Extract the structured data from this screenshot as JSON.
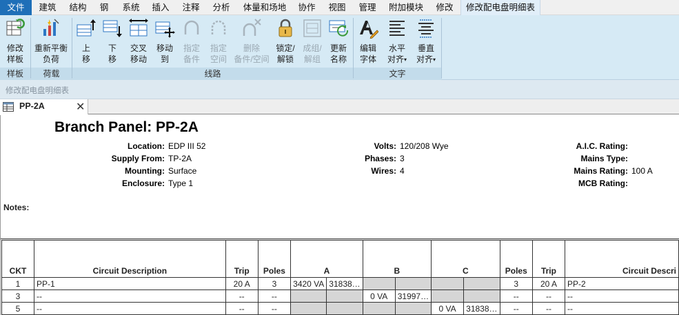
{
  "menubar": {
    "items": [
      "文件",
      "建筑",
      "结构",
      "钢",
      "系统",
      "插入",
      "注释",
      "分析",
      "体量和场地",
      "协作",
      "视图",
      "管理",
      "附加模块",
      "修改",
      "修改配电盘明细表"
    ]
  },
  "ribbon": {
    "tools": [
      {
        "line1": "修改",
        "line2": "样板",
        "icon": "modify-template-icon",
        "enabled": true
      },
      {
        "line1": "重新平衡",
        "line2": "负荷",
        "icon": "rebalance-loads-icon",
        "enabled": true
      },
      {
        "line1": "上",
        "line2": "移",
        "icon": "move-up-icon",
        "enabled": true
      },
      {
        "line1": "下",
        "line2": "移",
        "icon": "move-down-icon",
        "enabled": true
      },
      {
        "line1": "交叉",
        "line2": "移动",
        "icon": "move-across-icon",
        "enabled": true
      },
      {
        "line1": "移动",
        "line2": "到",
        "icon": "move-to-icon",
        "enabled": true
      },
      {
        "line1": "指定",
        "line2": "备件",
        "icon": "assign-spare-icon",
        "enabled": false
      },
      {
        "line1": "指定",
        "line2": "空间",
        "icon": "assign-space-icon",
        "enabled": false
      },
      {
        "line1": "删除",
        "line2": "备件/空间",
        "icon": "remove-spare-space-icon",
        "enabled": false
      },
      {
        "line1": "锁定/",
        "line2": "解锁",
        "icon": "lock-unlock-icon",
        "enabled": true
      },
      {
        "line1": "成组/",
        "line2": "解组",
        "icon": "group-ungroup-icon",
        "enabled": false
      },
      {
        "line1": "更新",
        "line2": "名称",
        "icon": "update-names-icon",
        "enabled": true
      },
      {
        "line1": "编辑",
        "line2": "字体",
        "icon": "edit-font-icon",
        "enabled": true
      },
      {
        "line1": "水平",
        "line2": "对齐",
        "icon": "align-horizontal-icon",
        "enabled": true
      },
      {
        "line1": "垂直",
        "line2": "对齐",
        "icon": "align-vertical-icon",
        "enabled": true
      }
    ],
    "panels": [
      "样板",
      "荷载",
      "线路",
      "文字"
    ],
    "context_label": "修改配电盘明细表"
  },
  "view_tab": {
    "label": "PP-2A",
    "icon": "schedule-view-icon",
    "close_icon": "close-icon"
  },
  "schedule": {
    "title": "Branch Panel: PP-2A",
    "header_fields": [
      {
        "label": "Location:",
        "value": "EDP III 52"
      },
      {
        "label": "Supply From:",
        "value": "TP-2A"
      },
      {
        "label": "Mounting:",
        "value": "Surface"
      },
      {
        "label": "Enclosure:",
        "value": "Type 1"
      },
      {
        "label": "Volts:",
        "value": "120/208 Wye"
      },
      {
        "label": "Phases:",
        "value": "3"
      },
      {
        "label": "Wires:",
        "value": "4"
      },
      {
        "label": "A.I.C. Rating:",
        "value": ""
      },
      {
        "label": "Mains Type:",
        "value": ""
      },
      {
        "label": "Mains Rating:",
        "value": "100 A"
      },
      {
        "label": "MCB Rating:",
        "value": ""
      }
    ],
    "notes_label": "Notes:",
    "columns": [
      "CKT",
      "Circuit Description",
      "Trip",
      "Poles",
      "A",
      "B",
      "C",
      "Poles",
      "Trip",
      "Circuit Descri"
    ],
    "rows": [
      [
        "1",
        "PP-1",
        "20 A",
        "3",
        "3420 VA",
        "31838…",
        "",
        "",
        "",
        "",
        "3",
        "20 A",
        "PP-2"
      ],
      [
        "3",
        "--",
        "--",
        "--",
        "",
        "",
        "0 VA",
        "31997…",
        "",
        "",
        "--",
        "--",
        "--"
      ],
      [
        "5",
        "--",
        "--",
        "--",
        "",
        "",
        "",
        "",
        "0 VA",
        "31838…",
        "--",
        "--",
        "--"
      ]
    ]
  }
}
